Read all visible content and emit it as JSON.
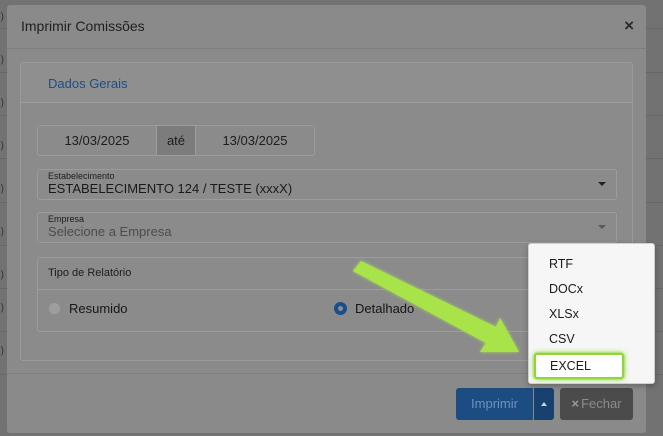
{
  "modal": {
    "title": "Imprimir Comissões",
    "close_symbol": "×"
  },
  "panel": {
    "tab_label": "Dados Gerais"
  },
  "date_range": {
    "start": "13/03/2025",
    "separator": "até",
    "end": "13/03/2025"
  },
  "estabelecimento": {
    "label": "Estabelecimento",
    "value": "ESTABELECIMENTO 124 / TESTE (xxxX)"
  },
  "empresa": {
    "label": "Empresa",
    "placeholder": "Selecione a Empresa"
  },
  "report_type": {
    "title": "Tipo de Relatório",
    "options": [
      {
        "label": "Resumido",
        "selected": false
      },
      {
        "label": "Detalhado",
        "selected": true
      }
    ]
  },
  "footer": {
    "print_label": "Imprimir",
    "close_label": "Fechar",
    "close_icon": "×"
  },
  "print_menu": {
    "items": [
      "RTF",
      "DOCx",
      "XLSx",
      "CSV",
      "EXCEL"
    ],
    "highlighted": "EXCEL"
  },
  "colors": {
    "primary": "#1b4c82",
    "highlight": "#8fd63a",
    "annotation_arrow": "#a7e34a"
  },
  "background_glyphs": [
    ")",
    ")",
    ")",
    ")",
    ")",
    ")",
    ")",
    ")",
    ")"
  ]
}
